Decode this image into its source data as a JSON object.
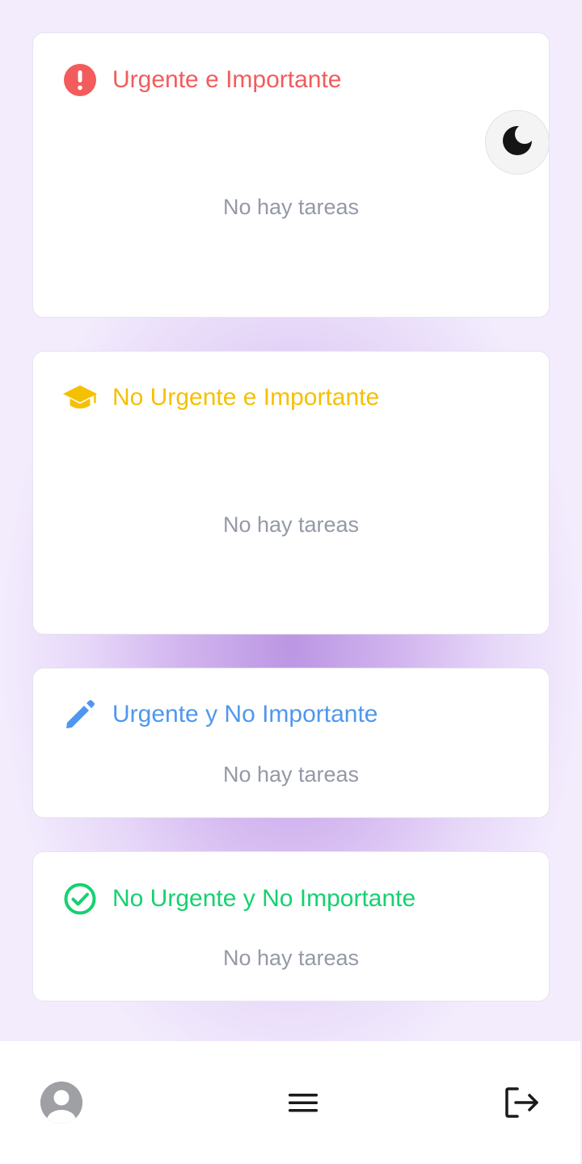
{
  "theme": {
    "accent": "#8e5bd4",
    "urgent_important_color": "#f25c5c",
    "not_urgent_important_color": "#f5c000",
    "urgent_not_important_color": "#4f97ee",
    "not_urgent_not_important_color": "#16d070"
  },
  "quadrants": [
    {
      "title": "Urgente e Importante",
      "icon": "exclamation-circle-icon",
      "empty_text": "No hay tareas"
    },
    {
      "title": "No Urgente e Importante",
      "icon": "graduation-cap-icon",
      "empty_text": "No hay tareas"
    },
    {
      "title": "Urgente y No Importante",
      "icon": "pencil-icon",
      "empty_text": "No hay tareas"
    },
    {
      "title": "No Urgente y No Importante",
      "icon": "check-circle-icon",
      "empty_text": "No hay tareas"
    }
  ],
  "theme_toggle": {
    "icon": "moon-icon"
  },
  "bottom_nav": {
    "profile_icon": "user-avatar-icon",
    "menu_icon": "hamburger-menu-icon",
    "logout_icon": "logout-icon"
  }
}
